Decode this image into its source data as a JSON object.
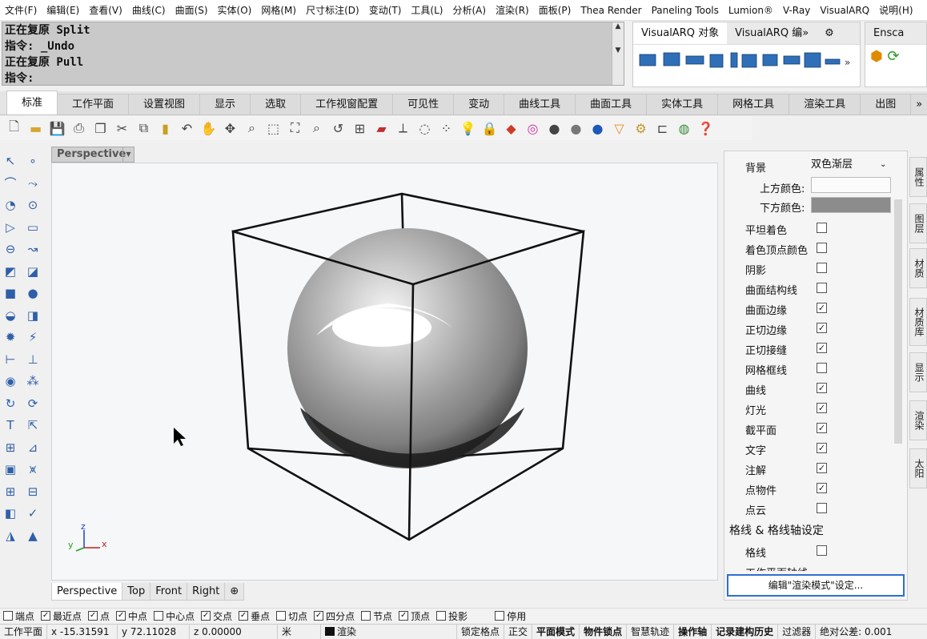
{
  "menubar": [
    "文件(F)",
    "编辑(E)",
    "查看(V)",
    "曲线(C)",
    "曲面(S)",
    "实体(O)",
    "网格(M)",
    "尺寸标注(D)",
    "变动(T)",
    "工具(L)",
    "分析(A)",
    "渲染(R)",
    "面板(P)",
    "Thea Render",
    "Paneling Tools",
    "Lumion®",
    "V-Ray",
    "VisualARQ",
    "说明(H)"
  ],
  "command_history": [
    "正在复原 Split",
    "指令: _Undo",
    "正在复原 Pull",
    "指令:"
  ],
  "plugin_panel": {
    "tab1": "VisualARQ 对象",
    "tab2": "VisualARQ 编»",
    "tab3": "Ensca"
  },
  "tabs": [
    "标准",
    "工作平面",
    "设置视图",
    "显示",
    "选取",
    "工作视窗配置",
    "可见性",
    "变动",
    "曲线工具",
    "曲面工具",
    "实体工具",
    "网格工具",
    "渲染工具",
    "出图"
  ],
  "tabs_more": "»",
  "viewport": {
    "name": "Perspective",
    "axis": {
      "x": "x",
      "y": "y",
      "z": "z"
    }
  },
  "viewport_tabs": [
    "Perspective",
    "Top",
    "Front",
    "Right"
  ],
  "viewport_add": "⊕",
  "display_panel": {
    "background_label": "背景",
    "background_value": "双色渐层",
    "top_color_label": "上方颜色:",
    "bottom_color_label": "下方颜色:",
    "items": [
      {
        "label": "平坦着色",
        "checked": false
      },
      {
        "label": "着色顶点颜色",
        "checked": false
      },
      {
        "label": "阴影",
        "checked": false
      },
      {
        "label": "曲面结构线",
        "checked": false
      },
      {
        "label": "曲面边缘",
        "checked": true
      },
      {
        "label": "正切边缘",
        "checked": true
      },
      {
        "label": "正切接缝",
        "checked": true
      },
      {
        "label": "网格框线",
        "checked": false
      },
      {
        "label": "曲线",
        "checked": true
      },
      {
        "label": "灯光",
        "checked": true
      },
      {
        "label": "截平面",
        "checked": true
      },
      {
        "label": "文字",
        "checked": true
      },
      {
        "label": "注解",
        "checked": true
      },
      {
        "label": "点物件",
        "checked": true
      },
      {
        "label": "点云",
        "checked": false
      }
    ],
    "grid_section": "格线 & 格线轴设定",
    "grid_label": "格线",
    "grid_cut_label": "工作平面轴线",
    "edit_button": "编辑\"渲染模式\"设定..."
  },
  "right_tabs": [
    "属性",
    "图层",
    "材质",
    "材质库",
    "显示",
    "渲染",
    "太阳"
  ],
  "osnap": [
    {
      "label": "端点",
      "checked": false
    },
    {
      "label": "最近点",
      "checked": true
    },
    {
      "label": "点",
      "checked": true
    },
    {
      "label": "中点",
      "checked": true
    },
    {
      "label": "中心点",
      "checked": false
    },
    {
      "label": "交点",
      "checked": true
    },
    {
      "label": "垂点",
      "checked": true
    },
    {
      "label": "切点",
      "checked": false
    },
    {
      "label": "四分点",
      "checked": true
    },
    {
      "label": "节点",
      "checked": false
    },
    {
      "label": "顶点",
      "checked": true
    },
    {
      "label": "投影",
      "checked": false
    },
    {
      "label": "停用",
      "checked": false
    }
  ],
  "status": {
    "plane": "工作平面",
    "x": "x -15.31591",
    "y": "y 72.11028",
    "z": "z 0.00000",
    "unit": "米",
    "layer": "渲染",
    "grid_snap": "锁定格点",
    "ortho": "正交",
    "planar": "平面模式",
    "osnap": "物件锁点",
    "smarttrack": "智慧轨迹",
    "gumball": "操作轴",
    "history": "记录建构历史",
    "filter": "过滤器",
    "tolerance": "绝对公差: 0.001"
  },
  "colors": {
    "accent": "#2f5fa8",
    "bottom_color": "#8c8c8c"
  }
}
